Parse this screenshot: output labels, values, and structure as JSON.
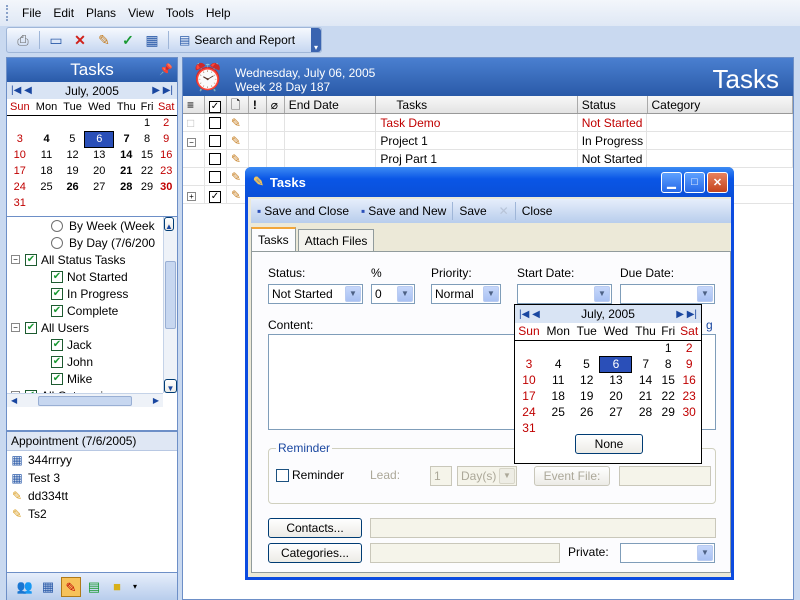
{
  "menu": [
    "File",
    "Edit",
    "Plans",
    "View",
    "Tools",
    "Help"
  ],
  "toolbar": {
    "search_label": "Search and Report"
  },
  "left": {
    "title": "Tasks",
    "calendar": {
      "month": "July, 2005",
      "weekdays": [
        "Sun",
        "Mon",
        "Tue",
        "Wed",
        "Thu",
        "Fri",
        "Sat"
      ],
      "weeks": [
        [
          "",
          "",
          "",
          "",
          "",
          "1",
          "2"
        ],
        [
          "3",
          "4",
          "5",
          "6",
          "7",
          "8",
          "9"
        ],
        [
          "10",
          "11",
          "12",
          "13",
          "14",
          "15",
          "16"
        ],
        [
          "17",
          "18",
          "19",
          "20",
          "21",
          "22",
          "23"
        ],
        [
          "24",
          "25",
          "26",
          "27",
          "28",
          "29",
          "30"
        ],
        [
          "31",
          "",
          "",
          "",
          "",
          "",
          ""
        ]
      ],
      "bold_days": [
        "4",
        "7",
        "14",
        "21",
        "26",
        "28",
        "30"
      ],
      "selected": "6"
    },
    "tree": {
      "by_week": "By Week (Week",
      "by_day": "By Day (7/6/200",
      "all_status": "All Status Tasks",
      "not_started": "Not Started",
      "in_progress": "In Progress",
      "complete": "Complete",
      "all_users": "All Users",
      "jack": "Jack",
      "john": "John",
      "mike": "Mike",
      "all_categories": "All Categories"
    },
    "appointment": {
      "header": "Appointment (7/6/2005)",
      "items": [
        "344rrryy",
        "Test 3",
        "dd334tt",
        "Ts2"
      ]
    }
  },
  "right": {
    "date_line1": "Wednesday, July 06, 2005",
    "date_line2": "Week 28  Day 187",
    "title": "Tasks",
    "columns": {
      "end_date": "End Date",
      "tasks": "Tasks",
      "status": "Status",
      "category": "Category"
    },
    "rows": [
      {
        "task": "Task Demo",
        "status": "Not Started"
      },
      {
        "task": "Project 1",
        "status": "In Progress"
      },
      {
        "task": "Proj Part 1",
        "status": "Not Started"
      }
    ]
  },
  "dialog": {
    "title": "Tasks",
    "tools": {
      "save_close": "Save and Close",
      "save_new": "Save and New",
      "save": "Save",
      "close": "Close"
    },
    "tabs": [
      "Tasks",
      "Attach Files"
    ],
    "status_label": "Status:",
    "status_value": "Not Started",
    "percent_label": "%",
    "percent_value": "0",
    "priority_label": "Priority:",
    "priority_value": "Normal",
    "start_label": "Start Date:",
    "due_label": "Due Date:",
    "content_label": "Content:",
    "reminder_group": "Reminder",
    "reminder_check": "Reminder",
    "lead_label": "Lead:",
    "lead_value": "1",
    "lead_unit": "Day(s)",
    "event_file": "Event File:",
    "contacts_btn": "Contacts...",
    "categories_btn": "Categories...",
    "private_label": "Private:",
    "hidden_edge": "g"
  },
  "popcal": {
    "month": "July, 2005",
    "weekdays": [
      "Sun",
      "Mon",
      "Tue",
      "Wed",
      "Thu",
      "Fri",
      "Sat"
    ],
    "weeks": [
      [
        "",
        "",
        "",
        "",
        "",
        "1",
        "2"
      ],
      [
        "3",
        "4",
        "5",
        "6",
        "7",
        "8",
        "9"
      ],
      [
        "10",
        "11",
        "12",
        "13",
        "14",
        "15",
        "16"
      ],
      [
        "17",
        "18",
        "19",
        "20",
        "21",
        "22",
        "23"
      ],
      [
        "24",
        "25",
        "26",
        "27",
        "28",
        "29",
        "30"
      ],
      [
        "31",
        "",
        "",
        "",
        "",
        "",
        ""
      ]
    ],
    "selected": "6",
    "none_label": "None"
  }
}
